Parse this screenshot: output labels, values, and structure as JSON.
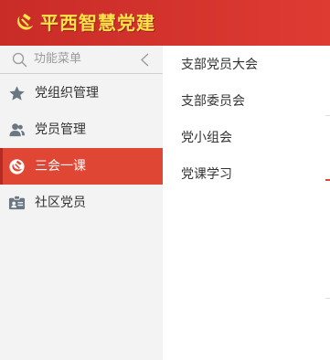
{
  "header": {
    "app_title": "平西智慧党建",
    "logo_icon": "hammer-sickle-icon",
    "accent_color": "#d8352f",
    "title_color": "#ffe34a"
  },
  "sidebar": {
    "search": {
      "placeholder": "功能菜单",
      "icon": "search-icon",
      "collapse_icon": "chevron-left-icon"
    },
    "items": [
      {
        "label": "党组织管理",
        "icon": "star-icon",
        "active": false
      },
      {
        "label": "党员管理",
        "icon": "users-icon",
        "active": false
      },
      {
        "label": "三会一课",
        "icon": "party-emblem-icon",
        "active": true
      },
      {
        "label": "社区党员",
        "icon": "id-card-icon",
        "active": false
      }
    ],
    "active_color": "#e04634"
  },
  "submenu": {
    "items": [
      {
        "label": "支部党员大会"
      },
      {
        "label": "支部委员会"
      },
      {
        "label": "党小组会"
      },
      {
        "label": "党课学习"
      }
    ]
  }
}
